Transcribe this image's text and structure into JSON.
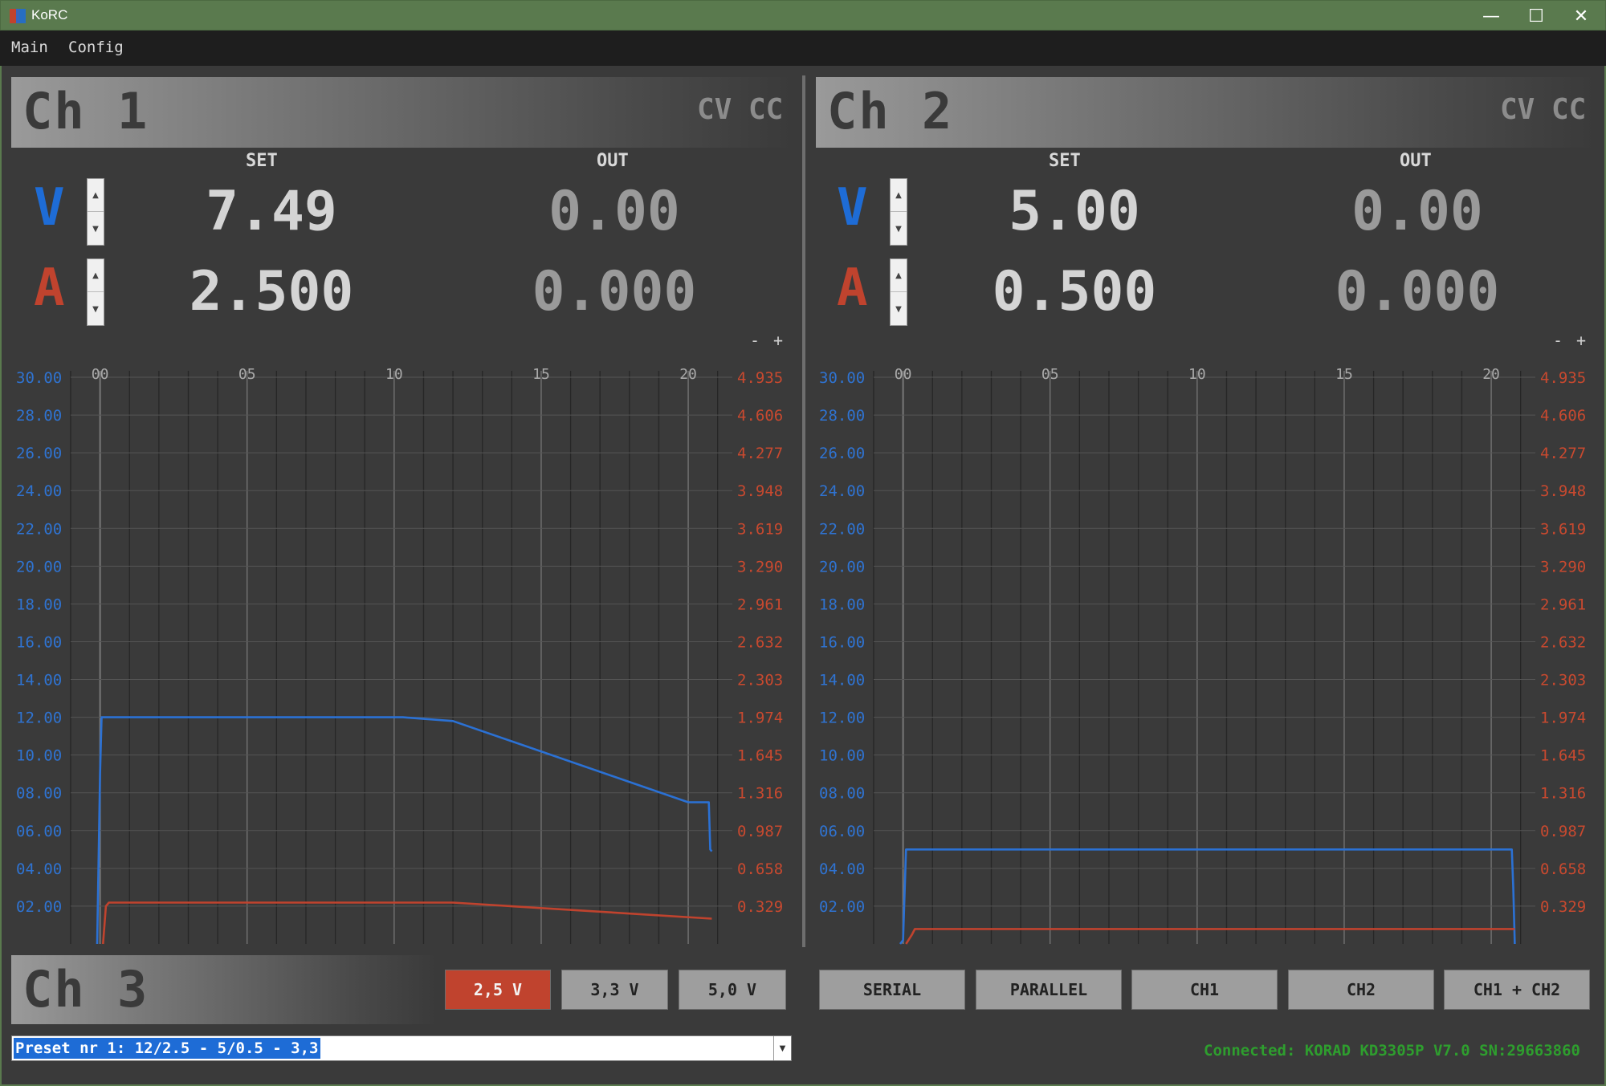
{
  "window": {
    "title": "KoRC"
  },
  "menu": [
    "Main",
    "Config"
  ],
  "channels": [
    {
      "title": "Ch 1",
      "modes": [
        "CV",
        "CC"
      ],
      "set_label": "SET",
      "out_label": "OUT",
      "v_label": "V",
      "a_label": "A",
      "set_voltage": "7.49",
      "set_current": "2.500",
      "out_voltage": "0.00",
      "out_current": "0.000",
      "zoom_minus": "-",
      "zoom_plus": "+"
    },
    {
      "title": "Ch 2",
      "modes": [
        "CV",
        "CC"
      ],
      "set_label": "SET",
      "out_label": "OUT",
      "v_label": "V",
      "a_label": "A",
      "set_voltage": "5.00",
      "set_current": "0.500",
      "out_voltage": "0.00",
      "out_current": "0.000",
      "zoom_minus": "-",
      "zoom_plus": "+"
    }
  ],
  "chart_data": [
    {
      "type": "line",
      "channel": "Ch 1",
      "x_ticks": [
        "00",
        "05",
        "10",
        "15",
        "20"
      ],
      "xlim": [
        -1,
        21.5
      ],
      "left_axis": {
        "ticks": [
          "30.00",
          "28.00",
          "26.00",
          "24.00",
          "22.00",
          "20.00",
          "18.00",
          "16.00",
          "14.00",
          "12.00",
          "10.00",
          "08.00",
          "06.00",
          "04.00",
          "02.00"
        ],
        "ylim": [
          0,
          30
        ],
        "color": "#2f73d1"
      },
      "right_axis": {
        "ticks": [
          "4.935",
          "4.606",
          "4.277",
          "3.948",
          "3.619",
          "3.290",
          "2.961",
          "2.632",
          "2.303",
          "1.974",
          "1.645",
          "1.316",
          "0.987",
          "0.658",
          "0.329"
        ],
        "ylim": [
          0,
          4.935
        ],
        "color": "#c8492f"
      },
      "series": [
        {
          "axis": "left",
          "color": "#2b71d4",
          "x": [
            -0.1,
            0.0,
            0.05,
            0.1,
            10.3,
            12.0,
            20.0,
            20.7,
            20.75,
            20.8
          ],
          "y": [
            0,
            9.0,
            12.0,
            12.0,
            12.0,
            11.8,
            7.5,
            7.5,
            5.0,
            4.9
          ]
        },
        {
          "axis": "right",
          "color": "#c0432e",
          "x": [
            0.1,
            0.2,
            0.3,
            12.0,
            20.8
          ],
          "y": [
            0,
            0.329,
            0.36,
            0.36,
            0.22
          ]
        }
      ]
    },
    {
      "type": "line",
      "channel": "Ch 2",
      "x_ticks": [
        "00",
        "05",
        "10",
        "15",
        "20"
      ],
      "xlim": [
        -1,
        21.5
      ],
      "left_axis": {
        "ticks": [
          "30.00",
          "28.00",
          "26.00",
          "24.00",
          "22.00",
          "20.00",
          "18.00",
          "16.00",
          "14.00",
          "12.00",
          "10.00",
          "08.00",
          "06.00",
          "04.00",
          "02.00"
        ],
        "ylim": [
          0,
          30
        ],
        "color": "#2f73d1"
      },
      "right_axis": {
        "ticks": [
          "4.935",
          "4.606",
          "4.277",
          "3.948",
          "3.619",
          "3.290",
          "2.961",
          "2.632",
          "2.303",
          "1.974",
          "1.645",
          "1.316",
          "0.987",
          "0.658",
          "0.329"
        ],
        "ylim": [
          0,
          4.935
        ],
        "color": "#c8492f"
      },
      "series": [
        {
          "axis": "left",
          "color": "#2b71d4",
          "x": [
            -0.1,
            0.0,
            0.1,
            20.7,
            20.75,
            20.8
          ],
          "y": [
            0,
            0.2,
            5.0,
            5.0,
            3.0,
            0
          ]
        },
        {
          "axis": "right",
          "color": "#c0432e",
          "x": [
            0.1,
            0.3,
            0.4,
            20.8
          ],
          "y": [
            0,
            0.08,
            0.13,
            0.13
          ]
        }
      ]
    }
  ],
  "ch3": {
    "title": "Ch 3",
    "presets": [
      {
        "label": "2,5 V",
        "active": true
      },
      {
        "label": "3,3 V",
        "active": false
      },
      {
        "label": "5,0 V",
        "active": false
      }
    ]
  },
  "mode_buttons": [
    "SERIAL",
    "PARALLEL",
    "CH1",
    "CH2",
    "CH1 + CH2"
  ],
  "preset_select": {
    "value": "Preset nr 1: 12/2.5 - 5/0.5 - 3,3"
  },
  "status": "Connected: KORAD KD3305P V7.0 SN:29663860",
  "colors": {
    "accent_voltage": "#1e6cd6",
    "accent_current": "#c0432e",
    "titlebar": "#5a7a4e",
    "status_ok": "#2e9e2e"
  }
}
